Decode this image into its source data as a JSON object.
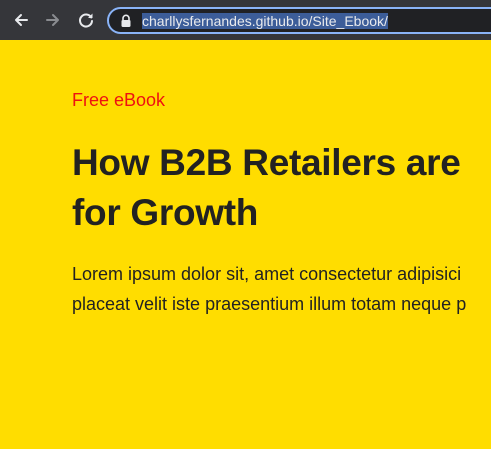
{
  "browser": {
    "url_display": "charllysfernandes.github.io/Site_Ebook/",
    "icons": {
      "back": "back-arrow-icon",
      "forward": "forward-arrow-icon",
      "reload": "reload-icon",
      "lock": "lock-icon"
    },
    "colors": {
      "toolbar": "#35363a",
      "omnibox_border": "#8ab4f8",
      "selection": "#3c5d99"
    }
  },
  "page": {
    "eyebrow": "Free eBook",
    "headline_line1": "How B2B Retailers are",
    "headline_line2": "for Growth",
    "body_line1": "Lorem ipsum dolor sit, amet consectetur adipisici",
    "body_line2": "placeat velit iste praesentium illum totam neque p",
    "colors": {
      "background": "#ffdd00",
      "eyebrow": "#ee1111",
      "text": "#222222"
    }
  }
}
